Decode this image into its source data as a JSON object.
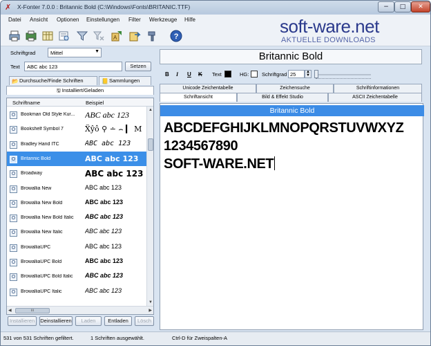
{
  "window": {
    "title": "X-Fonter 7.0.0  :  Britannic Bold  (C:\\Windows\\Fonts\\BRITANIC.TTF)",
    "minimize": "−",
    "maximize": "□",
    "close": "✕"
  },
  "menu": [
    "Datei",
    "Ansicht",
    "Optionen",
    "Einstellungen",
    "Filter",
    "Werkzeuge",
    "Hilfe"
  ],
  "logo": {
    "main": "soft-ware.net",
    "sub": "AKTUELLE DOWNLOADS"
  },
  "left": {
    "size_label": "Schriftgrad",
    "size_value": "Mittel",
    "text_label": "Text",
    "text_value": "ABC abc 123",
    "set_button": "Setzen",
    "tab_browse": "Durchsuche/Finde Schriften",
    "tab_collections": "Sammlungen",
    "tab_installed": "Installiert/Geladen",
    "col_name": "Schriftname",
    "col_sample": "Beispiel",
    "fonts": [
      {
        "name": "Bookman Old Style Kur...",
        "sample": "ABC abc 123",
        "font": "\"Liberation Serif\", serif",
        "style": "italic",
        "weight": "normal",
        "size": "12"
      },
      {
        "name": "Bookshelf Symbol 7",
        "sample": "Ẍŷô ⚲ ∸ ⌢ ▎ M",
        "font": "\"DejaVu Serif\", serif",
        "style": "normal",
        "weight": "normal",
        "size": "11"
      },
      {
        "name": "Bradley Hand ITC",
        "sample": "ABC abc 123",
        "font": "\"DejaVu Sans Mono\", monospace",
        "style": "italic",
        "weight": "normal",
        "size": "10"
      },
      {
        "name": "Britannic Bold",
        "sample": "ABC abc 123",
        "font": "\"DejaVu Sans\", sans-serif",
        "style": "normal",
        "weight": "bold",
        "size": "11",
        "selected": true
      },
      {
        "name": "Broadway",
        "sample": "ABC abc 123",
        "font": "\"DejaVu Sans\", sans-serif",
        "style": "normal",
        "weight": "bold",
        "size": "12"
      },
      {
        "name": "Browallia New",
        "sample": "ABC abc 123",
        "font": "\"Liberation Sans\", sans-serif",
        "style": "normal",
        "weight": "normal",
        "size": "9"
      },
      {
        "name": "Browallia New Bold",
        "sample": "ABC abc 123",
        "font": "\"Liberation Sans\", sans-serif",
        "style": "normal",
        "weight": "bold",
        "size": "9"
      },
      {
        "name": "Browallia New Bold Italic",
        "sample": "ABC abc 123",
        "font": "\"Liberation Sans\", sans-serif",
        "style": "italic",
        "weight": "bold",
        "size": "9"
      },
      {
        "name": "Browallia New Italic",
        "sample": "ABC abc 123",
        "font": "\"Liberation Sans\", sans-serif",
        "style": "italic",
        "weight": "normal",
        "size": "9"
      },
      {
        "name": "BrowalliaUPC",
        "sample": "ABC abc 123",
        "font": "\"Liberation Sans\", sans-serif",
        "style": "normal",
        "weight": "normal",
        "size": "9"
      },
      {
        "name": "BrowalliaUPC Bold",
        "sample": "ABC abc 123",
        "font": "\"Liberation Sans\", sans-serif",
        "style": "normal",
        "weight": "bold",
        "size": "9"
      },
      {
        "name": "BrowalliaUPC Bold Italic",
        "sample": "ABC abc 123",
        "font": "\"Liberation Sans\", sans-serif",
        "style": "italic",
        "weight": "bold",
        "size": "9"
      },
      {
        "name": "BrowalliaUPC Italic",
        "sample": "ABC abc 123",
        "font": "\"Liberation Sans\", sans-serif",
        "style": "italic",
        "weight": "normal",
        "size": "9"
      }
    ],
    "buttons": {
      "install": "Installieren",
      "uninstall": "Deinstallieren",
      "load": "Laden",
      "unload": "Entladen",
      "delete": "Lösch"
    }
  },
  "right": {
    "font_title": "Britannic Bold",
    "fmt_bold": "B",
    "fmt_italic": "I",
    "fmt_underline": "U",
    "fmt_strike": "K",
    "text_color_label": "Text",
    "bg_color_label": "HG:",
    "size_label": "Schriftgrad",
    "size_value": "25",
    "text_color": "#000000",
    "bg_color": "#ffffff",
    "tabs_row1": [
      "Unicode Zeichentabelle",
      "Zeichensuche",
      "Schriftinformationen"
    ],
    "tabs_row2": [
      "Schriftansicht",
      "Bild & Effekt Studio",
      "ASCII Zeichentabelle"
    ],
    "preview_header": "Britannic Bold",
    "preview_lines": [
      "ABCDEFGHIJKLMNOPQRSTUVWXYZ",
      "1234567890",
      "SOFT-WARE.NET"
    ]
  },
  "status": {
    "filtered": "531 von 531 Schriften gefiltert.",
    "selected": "1 Schriften ausgewählt.",
    "hint": "Ctrl-D für Zweispalten-A"
  },
  "colors": {
    "selection": "#3b8fe8",
    "preview_header": "#3c8ce6",
    "logo": "#2b3a8c"
  }
}
